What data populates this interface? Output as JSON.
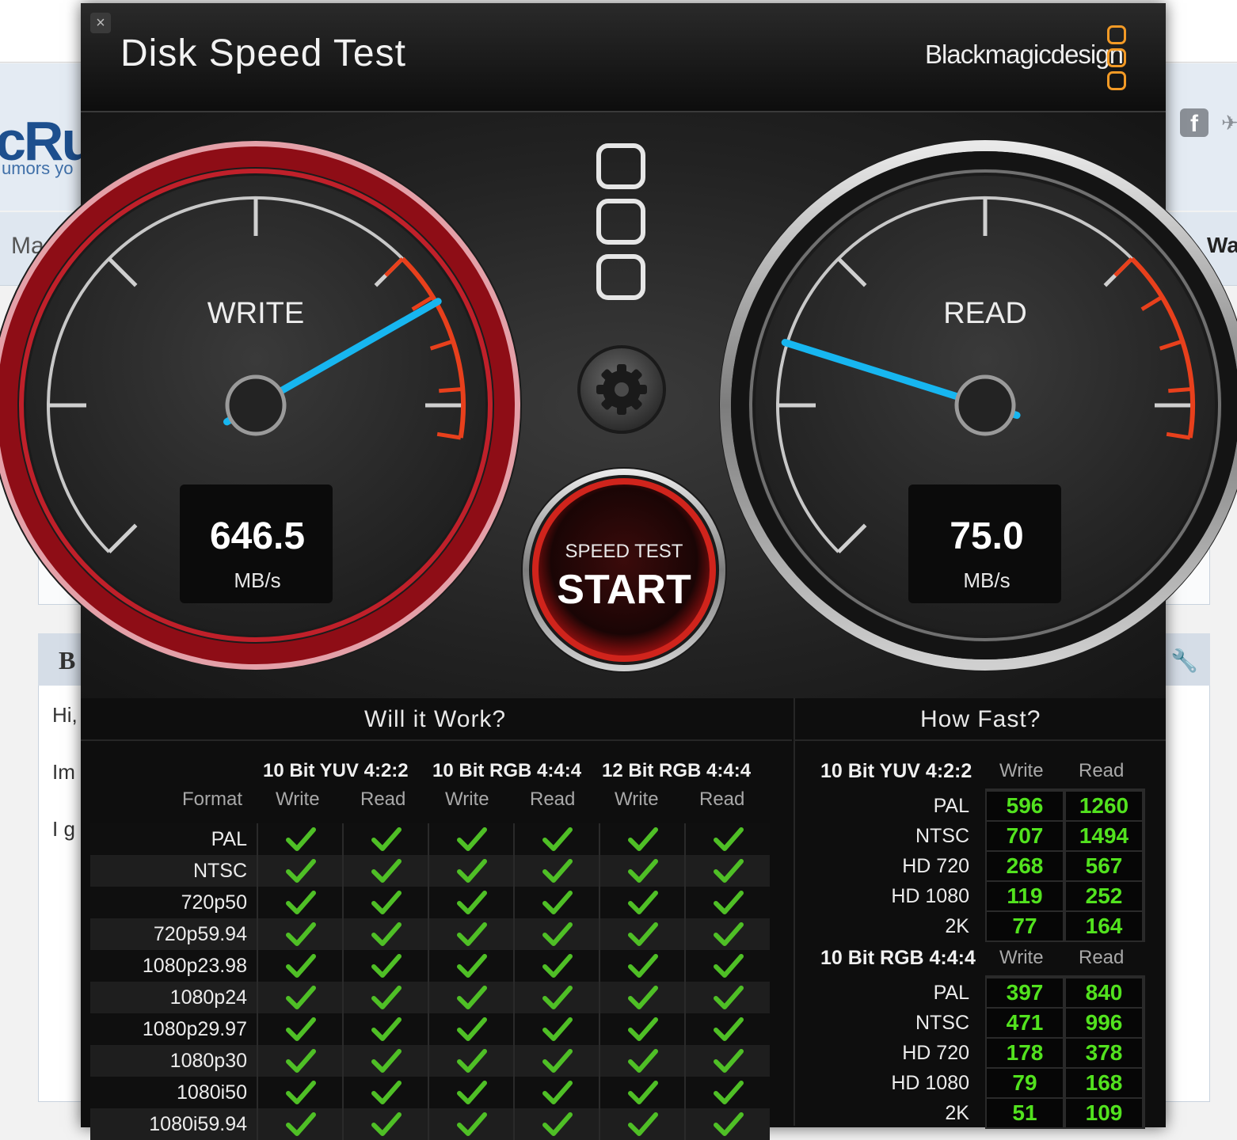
{
  "background_page": {
    "logo_fragment": "cRu",
    "tagline_fragment": "umors yo",
    "nav_left_fragment": "Ma",
    "nav_right_fragment": "Wa",
    "panel_heading_fragment": "B",
    "text_lines": [
      "Hi,",
      "Im",
      "I g"
    ]
  },
  "app": {
    "title": "Disk Speed Test",
    "brand": "Blackmagicdesign",
    "close_label": "×"
  },
  "write_gauge": {
    "label": "WRITE",
    "value": "646.5",
    "unit": "MB/s",
    "speed_mbps": 646.5,
    "color": "#c0141a"
  },
  "read_gauge": {
    "label": "READ",
    "value": "75.0",
    "unit": "MB/s",
    "speed_mbps": 75.0,
    "color": "#b0b0b0"
  },
  "start_button": {
    "top_label": "SPEED TEST",
    "main_label": "START"
  },
  "settings_icon": "gear-icon",
  "will_it_work": {
    "title": "Will it Work?",
    "format_label": "Format",
    "groups": [
      "10 Bit YUV 4:2:2",
      "10 Bit RGB 4:4:4",
      "12 Bit RGB 4:4:4"
    ],
    "sub_headers": [
      "Write",
      "Read",
      "Write",
      "Read",
      "Write",
      "Read"
    ],
    "rows": [
      "PAL",
      "NTSC",
      "720p50",
      "720p59.94",
      "1080p23.98",
      "1080p24",
      "1080p29.97",
      "1080p30",
      "1080i50",
      "1080i59.94"
    ],
    "check_color": "#4fbf26"
  },
  "how_fast": {
    "title": "How Fast?",
    "sections": [
      {
        "name": "10 Bit YUV 4:2:2",
        "write_label": "Write",
        "read_label": "Read",
        "rows": [
          {
            "format": "PAL",
            "write": "596",
            "read": "1260"
          },
          {
            "format": "NTSC",
            "write": "707",
            "read": "1494"
          },
          {
            "format": "HD 720",
            "write": "268",
            "read": "567"
          },
          {
            "format": "HD 1080",
            "write": "119",
            "read": "252"
          },
          {
            "format": "2K",
            "write": "77",
            "read": "164"
          }
        ]
      },
      {
        "name": "10 Bit RGB 4:4:4",
        "write_label": "Write",
        "read_label": "Read",
        "rows": [
          {
            "format": "PAL",
            "write": "397",
            "read": "840"
          },
          {
            "format": "NTSC",
            "write": "471",
            "read": "996"
          },
          {
            "format": "HD 720",
            "write": "178",
            "read": "378"
          },
          {
            "format": "HD 1080",
            "write": "79",
            "read": "168"
          },
          {
            "format": "2K",
            "write": "51",
            "read": "109"
          }
        ]
      }
    ],
    "value_color": "#52e21e"
  }
}
